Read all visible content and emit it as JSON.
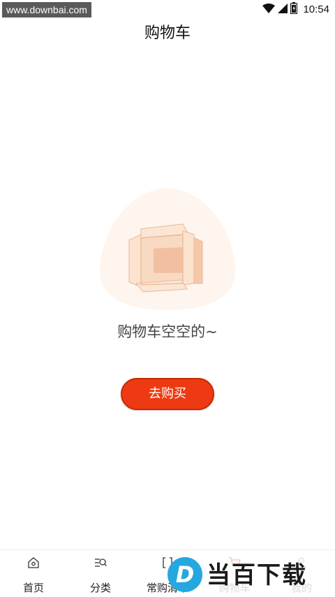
{
  "status_bar": {
    "watermark": "www.downbai.com",
    "time": "10:54"
  },
  "header": {
    "title": "购物车"
  },
  "empty_state": {
    "message": "购物车空空的~",
    "button_label": "去购买"
  },
  "tabbar": {
    "tabs": [
      {
        "label": "首页",
        "icon": "home-icon"
      },
      {
        "label": "分类",
        "icon": "category-search-icon"
      },
      {
        "label": "常购清单",
        "icon": "list-icon"
      },
      {
        "label": "购物车",
        "icon": "cart-icon"
      },
      {
        "label": "我的",
        "icon": "user-icon"
      }
    ]
  },
  "watermark_logo": {
    "letter": "D",
    "text": "当百下载"
  },
  "colors": {
    "accent": "#ee3a12",
    "active_tab": "#f08a6e",
    "watermark_blue": "#25a8e0"
  }
}
